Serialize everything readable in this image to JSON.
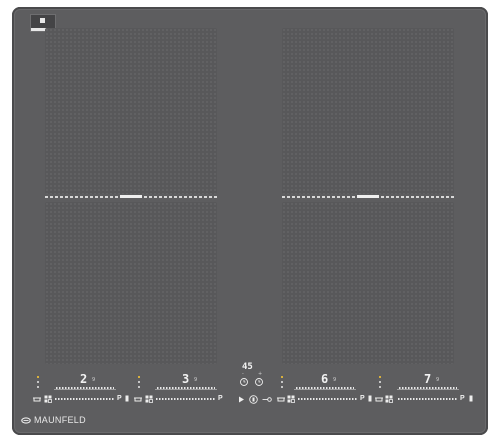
{
  "brand": {
    "name": "MAUNFELD"
  },
  "colors": {
    "glass": "#5d5d5f",
    "zone": "#58585a",
    "indicator": "#ffcc33",
    "text": "#ececec"
  },
  "zones": [
    {
      "name": "zone-front-left",
      "level": "2",
      "max": "9"
    },
    {
      "name": "zone-rear-left",
      "level": "3",
      "max": "9"
    },
    {
      "name": "zone-front-right",
      "level": "6",
      "max": "9"
    },
    {
      "name": "zone-rear-right",
      "level": "7",
      "max": "9"
    }
  ],
  "timer": {
    "value": "45",
    "minus": "-",
    "plus": "+"
  },
  "controls": {
    "power_boost": "P",
    "pause_icon": "play-icon",
    "lock_icon": "lock-icon",
    "key_lock_icon": "key-icon"
  }
}
